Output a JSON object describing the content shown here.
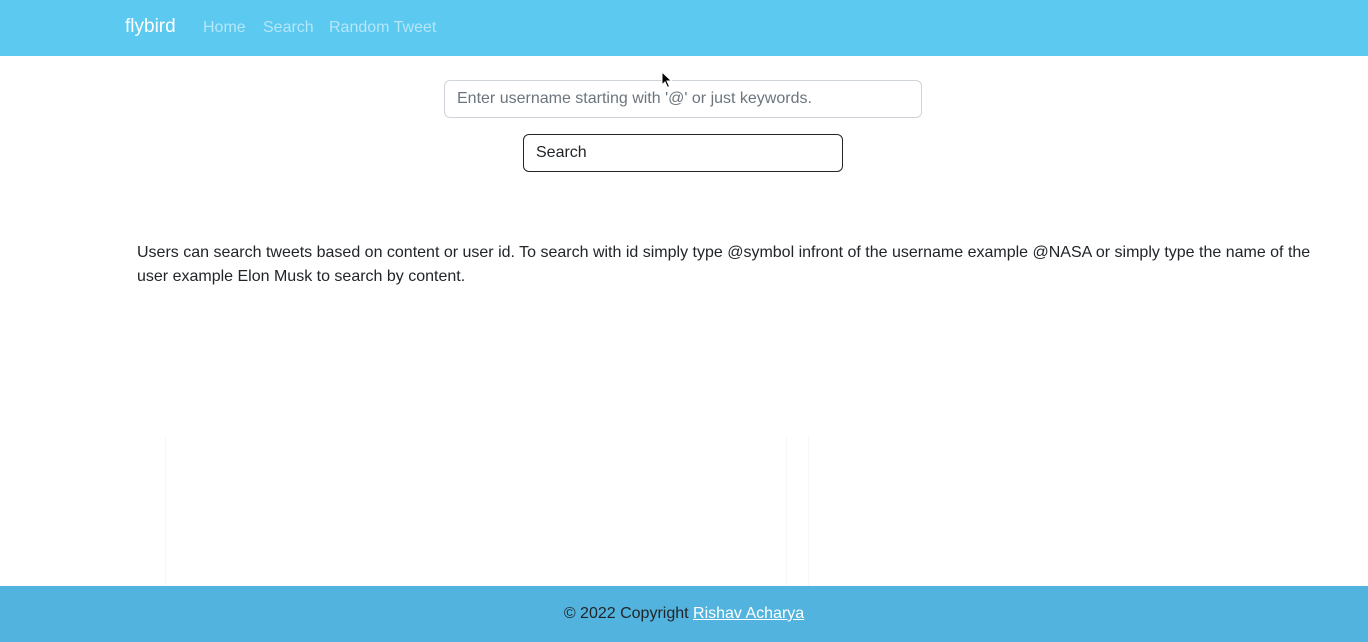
{
  "navbar": {
    "brand": "flybird",
    "links": [
      "Home",
      "Search",
      "Random Tweet"
    ]
  },
  "search": {
    "placeholder": "Enter username starting with '@' or just keywords.",
    "value": "",
    "button_label": "Search"
  },
  "description": "Users can search tweets based on content or user id. To search with id simply type @symbol infront of the username example @NASA or simply type the name of the user example Elon Musk to search by content.",
  "footer": {
    "copyright": "© 2022 Copyright",
    "author": "Rishav Acharya"
  },
  "colors": {
    "navbar": "#5bc9f0",
    "footer": "#52b4de"
  },
  "icons": {
    "cursor": "mouse-pointer-icon"
  }
}
